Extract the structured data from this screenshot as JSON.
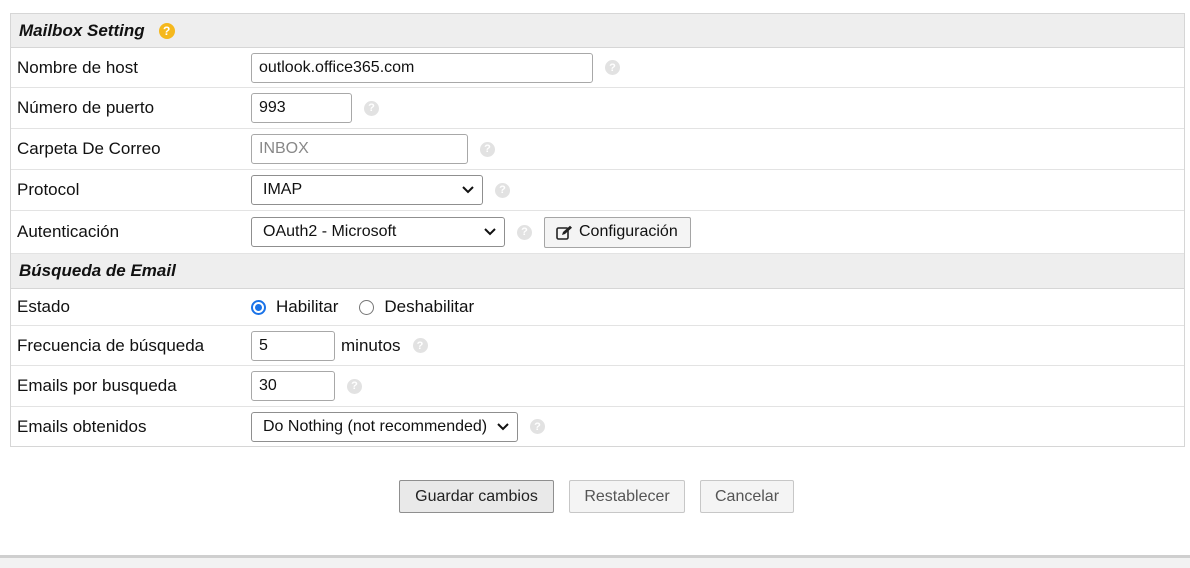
{
  "mailbox": {
    "title": "Mailbox Setting",
    "warn_icon": "warning-question-icon",
    "host_label": "Nombre de host",
    "host_value": "outlook.office365.com",
    "port_label": "Número de puerto",
    "port_value": "993",
    "folder_label": "Carpeta De Correo",
    "folder_placeholder": "INBOX",
    "protocol_label": "Protocol",
    "protocol_value": "IMAP",
    "auth_label": "Autenticación",
    "auth_value": "OAuth2 - Microsoft",
    "config_button": "Configuración",
    "config_icon": "edit-icon"
  },
  "search": {
    "title": "Búsqueda de Email",
    "status_label": "Estado",
    "enable_label": "Habilitar",
    "disable_label": "Deshabilitar",
    "selected": "Habilitar",
    "frequency_label": "Frecuencia de búsqueda",
    "frequency_value": "5",
    "frequency_unit": "minutos",
    "per_search_label": "Emails por busqueda",
    "per_search_value": "30",
    "fetched_label": "Emails obtenidos",
    "fetched_value": "Do Nothing (not recommended)"
  },
  "actions": {
    "save": "Guardar cambios",
    "reset": "Restablecer",
    "cancel": "Cancelar"
  },
  "colors": {
    "header_bg": "#eeeeee",
    "warn": "#f5b81d",
    "radio_accent": "#1a73e8",
    "help_icon": "#e2e2e2"
  }
}
